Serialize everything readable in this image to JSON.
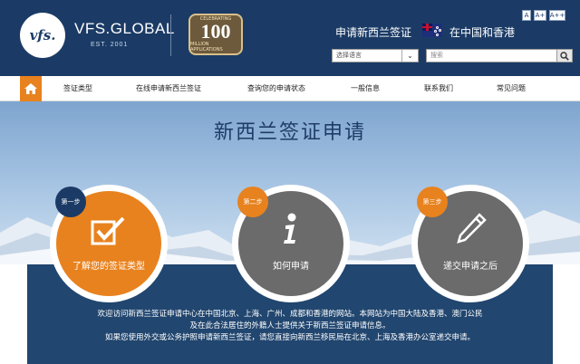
{
  "header": {
    "logo_text": "vfs.",
    "brand": "VFS.GLOBAL",
    "est": "EST. 2001",
    "badge": {
      "top": "CELEBRATING",
      "number": "100",
      "sub": "MILLION APPLICATIONS"
    },
    "title": "申请新西兰签证",
    "region": "在中国和香港",
    "font_sizes": [
      "A",
      "A+",
      "A++"
    ],
    "language_select": "选择语言",
    "search_placeholder": "搜索"
  },
  "nav": {
    "items": [
      "签证类型",
      "在线申请新西兰签证",
      "查询您的申请状态",
      "一般信息",
      "联系我们",
      "常见问题"
    ]
  },
  "hero": {
    "title": "新西兰签证申请"
  },
  "steps": [
    {
      "badge": "第一步",
      "label": "了解您的签证类型",
      "icon": "checkbox-icon"
    },
    {
      "badge": "第二步",
      "label": "如何申请",
      "icon": "info-icon"
    },
    {
      "badge": "第三步",
      "label": "递交申请之后",
      "icon": "pen-icon"
    }
  ],
  "panel": {
    "line1": "欢迎访问新西兰签证申请中心在中国北京、上海、广州、成都和香港的网站。本网站为中国大陆及香港、澳门公民",
    "line2": "及在此合法居住的外籍人士提供关于新西兰签证申请信息。",
    "line3": "如果您使用外交或公务护照申请新西兰签证，请您直接向新西兰移民局在北京、上海及香港办公室递交申请。"
  },
  "colors": {
    "navy": "#1b3b66",
    "orange": "#e8821e",
    "gray": "#6b6b6b",
    "panel": "#21466f"
  }
}
